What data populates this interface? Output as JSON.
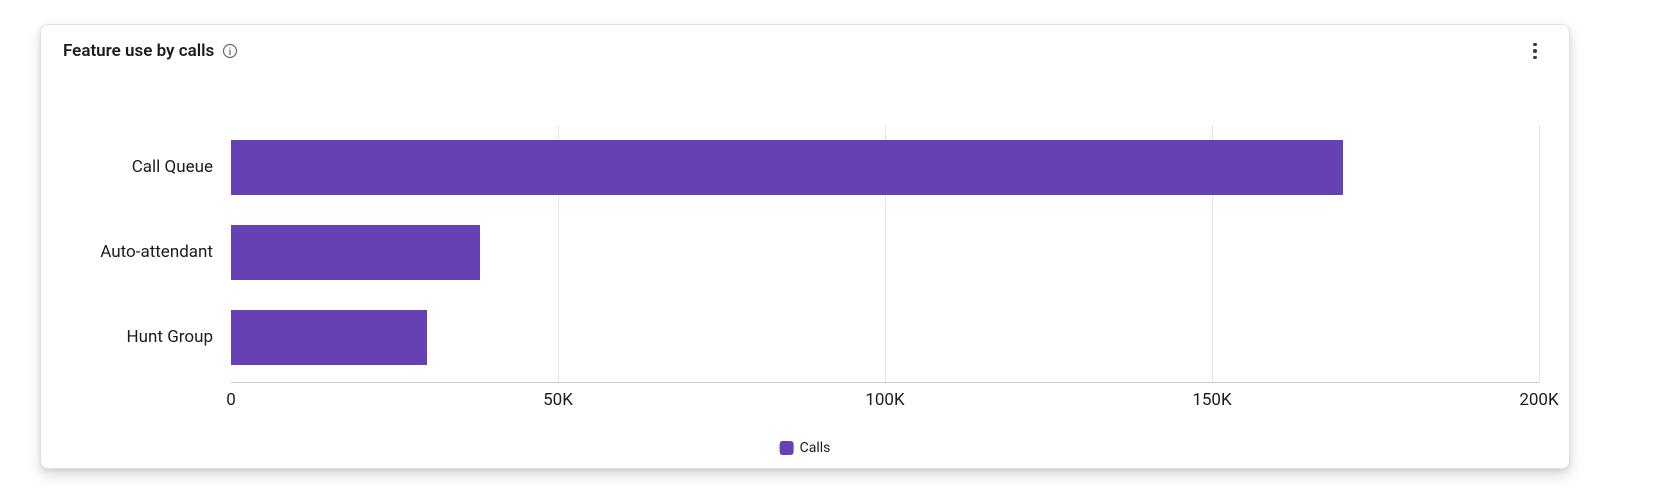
{
  "card": {
    "title": "Feature use by calls"
  },
  "legend": {
    "label": "Calls"
  },
  "chart_data": {
    "type": "bar",
    "orientation": "horizontal",
    "categories": [
      "Call Queue",
      "Auto-attendant",
      "Hunt Group"
    ],
    "values": [
      170000,
      38000,
      30000
    ],
    "bar_color": "#6541B3",
    "xlim": [
      0,
      200000
    ],
    "x_ticks": [
      0,
      50000,
      100000,
      150000,
      200000
    ],
    "x_tick_labels": [
      "0",
      "50K",
      "100K",
      "150K",
      "200K"
    ],
    "title": "Feature use by calls",
    "xlabel": "",
    "ylabel": "",
    "series": [
      {
        "name": "Calls",
        "values": [
          170000,
          38000,
          30000
        ]
      }
    ]
  }
}
